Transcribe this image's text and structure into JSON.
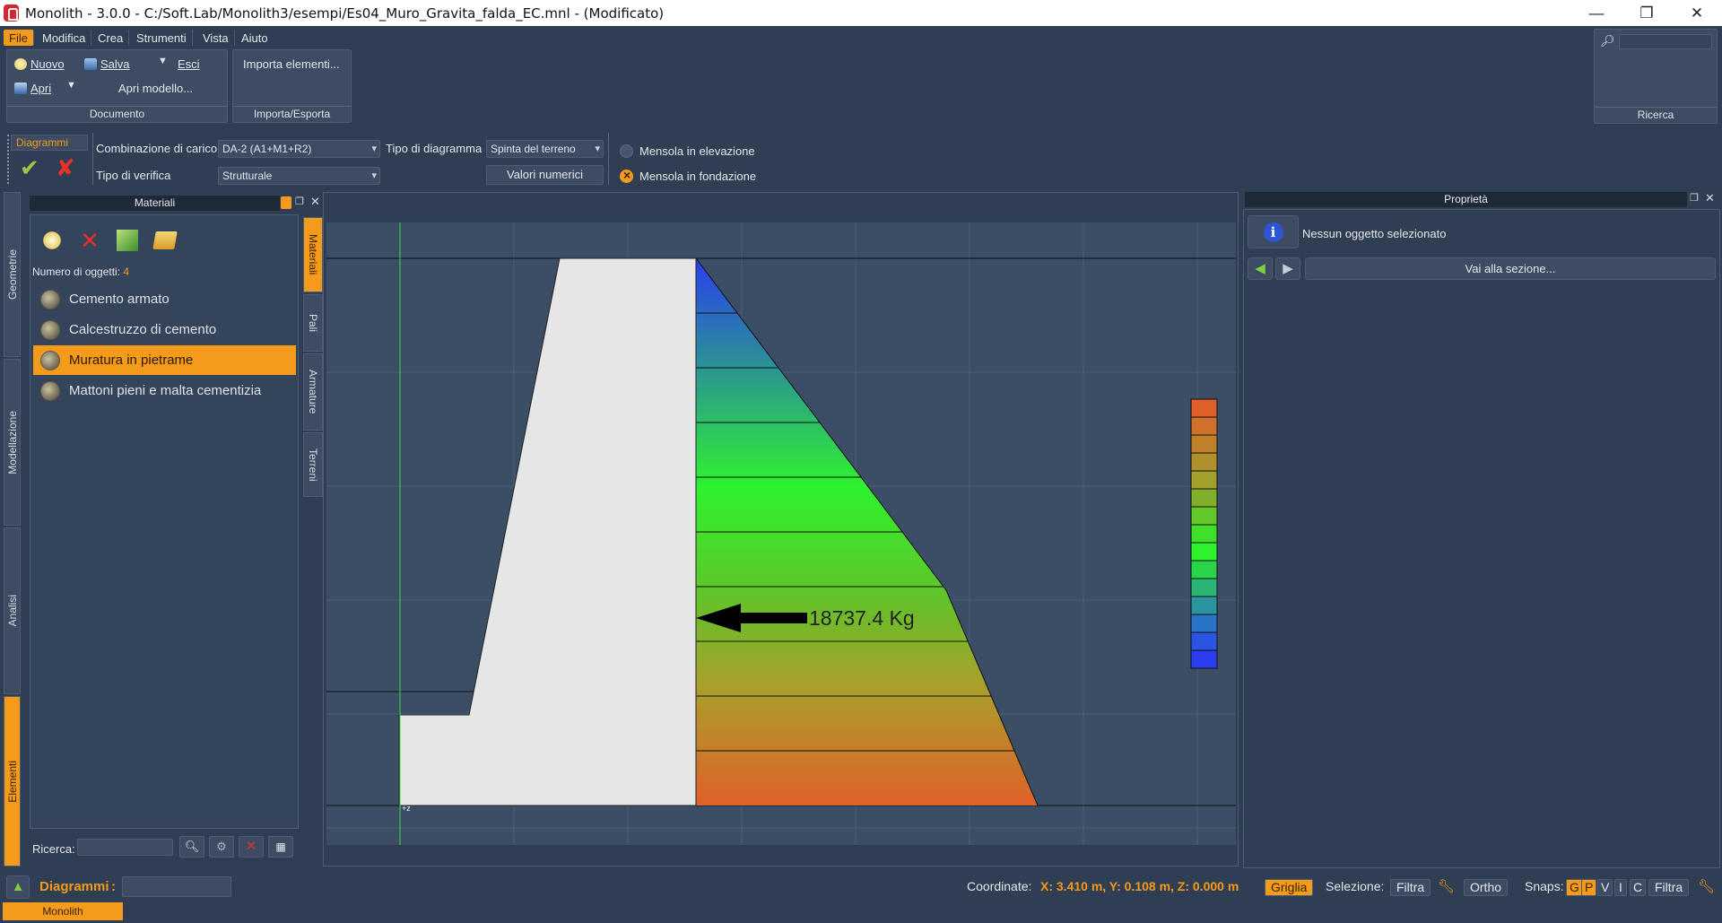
{
  "window": {
    "title": "Monolith - 3.0.0 - C:/Soft.Lab/Monolith3/esempi/Es04_Muro_Gravita_falda_EC.mnl - (Modificato)",
    "minimize": "—",
    "maximize": "❐",
    "close": "✕"
  },
  "menu": {
    "items": [
      "File",
      "Modifica",
      "Crea",
      "Strumenti",
      "Vista",
      "Aiuto"
    ]
  },
  "ribbon": {
    "document": {
      "nuovo": "Nuovo",
      "salva": "Salva",
      "esci": "Esci",
      "apri": "Apri",
      "apri_modello": "Apri modello...",
      "label": "Documento"
    },
    "import_export": {
      "importa": "Importa elementi...",
      "label": "Importa/Esporta"
    },
    "search": {
      "label": "Ricerca",
      "value": ""
    }
  },
  "diagram_toolbar": {
    "tab": "Diagrammi",
    "combinazione_label": "Combinazione di carico",
    "combinazione_value": "DA-2 (A1+M1+R2)",
    "tipo_verifica_label": "Tipo di verifica",
    "tipo_verifica_value": "Strutturale",
    "tipo_diagramma_label": "Tipo di diagramma",
    "tipo_diagramma_value": "Spinta del terreno",
    "valori_numerici": "Valori numerici",
    "mensola_elevazione": "Mensola in elevazione",
    "mensola_fondazione": "Mensola in fondazione"
  },
  "left_tabs": [
    "Geometrie",
    "Modellazione",
    "Analisi",
    "Elementi"
  ],
  "materials_panel": {
    "title": "Materiali",
    "count_label": "Numero di oggetti:",
    "count": "4",
    "items": [
      "Cemento armato",
      "Calcestruzzo di cemento",
      "Muratura in pietrame",
      "Mattoni pieni e malta cementizia"
    ],
    "selected_index": 2,
    "search_label": "Ricerca:",
    "search_value": ""
  },
  "side_tabs": [
    "Materiali",
    "Pali",
    "Armature",
    "Terreni"
  ],
  "canvas": {
    "force_label": "18737.4 Kg",
    "axis_marker": "+z",
    "colors": {
      "low": "#2a3ef0",
      "mid": "#2ef22e",
      "high": "#e0602a",
      "wall": "#e6e6e6",
      "background": "#3c4d66"
    }
  },
  "properties_panel": {
    "title": "Proprietà",
    "info": "Nessun oggetto selezionato",
    "goto": "Vai alla sezione..."
  },
  "statusbar": {
    "mode_label": "Diagrammi",
    "coord_label": "Coordinate:",
    "coord_value": "X: 3.410 m, Y: 0.108 m, Z: 0.000 m",
    "griglia": "Griglia",
    "selezione_label": "Selezione:",
    "filtra": "Filtra",
    "ortho": "Ortho",
    "snaps_label": "Snaps:",
    "snaps": [
      "G",
      "P",
      "V",
      "I",
      "C"
    ],
    "filtra2": "Filtra",
    "bottom_tab": "Monolith"
  }
}
